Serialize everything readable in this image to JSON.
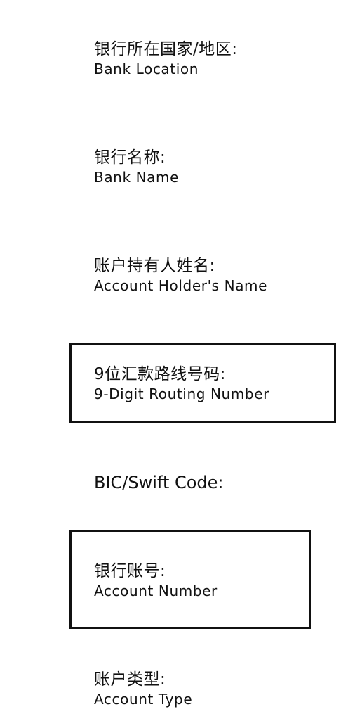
{
  "fields": [
    {
      "zh": "银行所在国家/地区:",
      "en": "Bank Location"
    },
    {
      "zh": "银行名称:",
      "en": "Bank Name"
    },
    {
      "zh": "账户持有人姓名:",
      "en": "Account Holder's Name"
    },
    {
      "zh": "9位汇款路线号码:",
      "en": "9-Digit Routing Number",
      "boxed": true
    },
    {
      "label": "BIC/Swift Code:"
    },
    {
      "zh": "银行账号:",
      "en": "Account Number",
      "boxed": true
    },
    {
      "zh": "账户类型:",
      "en": "Account Type"
    }
  ]
}
